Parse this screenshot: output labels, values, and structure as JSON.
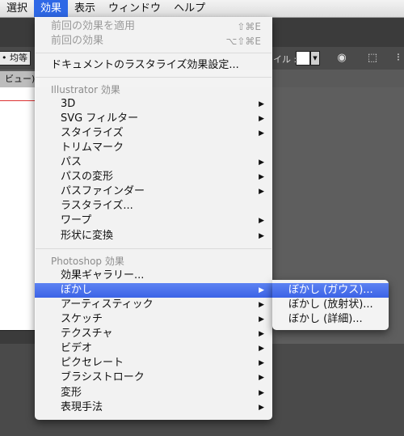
{
  "menubar": {
    "items": [
      {
        "label": "選択"
      },
      {
        "label": "効果"
      },
      {
        "label": "表示"
      },
      {
        "label": "ウィンドウ"
      },
      {
        "label": "ヘルプ"
      }
    ]
  },
  "toolbar": {
    "style_field": "• 均等",
    "fill_label": "イル :",
    "swatch_color": "#ffffff"
  },
  "tabbar": {
    "tab_label": "ビュー)"
  },
  "menu": {
    "apply_last": {
      "label": "前回の効果を適用",
      "shortcut": "⇧⌘E"
    },
    "last_effect": {
      "label": "前回の効果",
      "shortcut": "⌥⇧⌘E"
    },
    "document_raster": {
      "label": "ドキュメントのラスタライズ効果設定..."
    },
    "illustrator_header": "Illustrator 効果",
    "illustrator_items": [
      {
        "label": "3D"
      },
      {
        "label": "SVG フィルター"
      },
      {
        "label": "スタイライズ"
      },
      {
        "label": "トリムマーク"
      },
      {
        "label": "パス"
      },
      {
        "label": "パスの変形"
      },
      {
        "label": "パスファインダー"
      },
      {
        "label": "ラスタライズ..."
      },
      {
        "label": "ワープ"
      },
      {
        "label": "形状に変換"
      }
    ],
    "photoshop_header": "Photoshop 効果",
    "photoshop_items": [
      {
        "label": "効果ギャラリー..."
      },
      {
        "label": "ぼかし"
      },
      {
        "label": "アーティスティック"
      },
      {
        "label": "スケッチ"
      },
      {
        "label": "テクスチャ"
      },
      {
        "label": "ビデオ"
      },
      {
        "label": "ピクセレート"
      },
      {
        "label": "ブラシストローク"
      },
      {
        "label": "変形"
      },
      {
        "label": "表現手法"
      }
    ]
  },
  "submenu": {
    "items": [
      {
        "label": "ぼかし (ガウス)..."
      },
      {
        "label": "ぼかし (放射状)..."
      },
      {
        "label": "ぼかし (詳細)..."
      }
    ]
  }
}
